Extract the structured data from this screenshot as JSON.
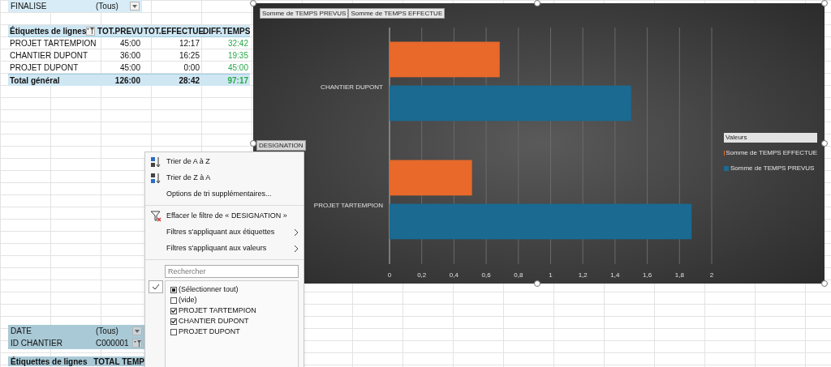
{
  "filter_top": {
    "label": "FINALISE",
    "value": "(Tous)",
    "filtered": false
  },
  "pivot": {
    "columns": [
      "Étiquettes de lignes",
      "TOT.PREVU",
      "TOT.EFFECTUE",
      "DIFF.TEMPS"
    ],
    "header_filtered": true,
    "rows": [
      {
        "cells": [
          "PROJET TARTEMPION",
          "45:00",
          "12:17",
          "32:42"
        ]
      },
      {
        "cells": [
          "CHANTIER DUPONT",
          "36:00",
          "16:25",
          "19:35"
        ]
      },
      {
        "cells": [
          "PROJET DUPONT",
          "45:00",
          "0:00",
          "45:00"
        ]
      }
    ],
    "total": [
      "Total général",
      "126:00",
      "28:42",
      "97:17"
    ]
  },
  "chart": {
    "field_buttons": [
      "Somme de TEMPS PREVUS",
      "Somme de TEMPS EFFECTUE"
    ],
    "axis_field": "DESIGNATION",
    "legend_title": "Valeurs",
    "chart_data": {
      "type": "bar",
      "orientation": "horizontal",
      "grid": true,
      "categories": [
        "CHANTIER DUPONT",
        "PROJET TARTEMPION"
      ],
      "series": [
        {
          "name": "Somme de TEMPS EFFECTUE",
          "color": "#e8692a",
          "values": [
            0.684,
            0.512
          ]
        },
        {
          "name": "Somme de TEMPS PREVUS",
          "color": "#1a6a92",
          "values": [
            1.5,
            1.875
          ]
        }
      ],
      "xlim": [
        0,
        2
      ],
      "xticks": [
        {
          "value": 0,
          "label": "0"
        },
        {
          "value": 0.2,
          "label": "0,2"
        },
        {
          "value": 0.4,
          "label": "0,4"
        },
        {
          "value": 0.6,
          "label": "0,6"
        },
        {
          "value": 0.8,
          "label": "0,8"
        },
        {
          "value": 1,
          "label": "1"
        },
        {
          "value": 1.2,
          "label": "1,2"
        },
        {
          "value": 1.4,
          "label": "1,4"
        },
        {
          "value": 1.6,
          "label": "1,6"
        },
        {
          "value": 1.8,
          "label": "1,8"
        },
        {
          "value": 2,
          "label": "2"
        }
      ]
    }
  },
  "menu": {
    "items": [
      {
        "kind": "sort-az",
        "label": "Trier de A à Z"
      },
      {
        "kind": "sort-za",
        "label": "Trier de Z à A"
      },
      {
        "kind": "plain",
        "label": "Options de tri supplémentaires..."
      },
      {
        "kind": "clear",
        "label": "Effacer le filtre de « DESIGNATION »"
      },
      {
        "kind": "submenu",
        "label": "Filtres s'appliquant aux étiquettes"
      },
      {
        "kind": "submenu",
        "label": "Filtres s'appliquant aux valeurs"
      }
    ],
    "search_placeholder": "Rechercher",
    "checklist": [
      {
        "label": "(Sélectionner tout)",
        "checked": false,
        "partial": true
      },
      {
        "label": "(vide)",
        "checked": false
      },
      {
        "label": "PROJET TARTEMPION",
        "checked": true
      },
      {
        "label": "CHANTIER DUPONT",
        "checked": true
      },
      {
        "label": "PROJET DUPONT",
        "checked": false
      }
    ]
  },
  "bottom_filters": [
    {
      "label": "DATE",
      "value": "(Tous)",
      "filtered": false
    },
    {
      "label": "ID CHANTIER",
      "value": "C000001",
      "filtered": true
    }
  ],
  "bottom_header": [
    "Étiquettes de lignes",
    "TOTAL TEMP"
  ]
}
